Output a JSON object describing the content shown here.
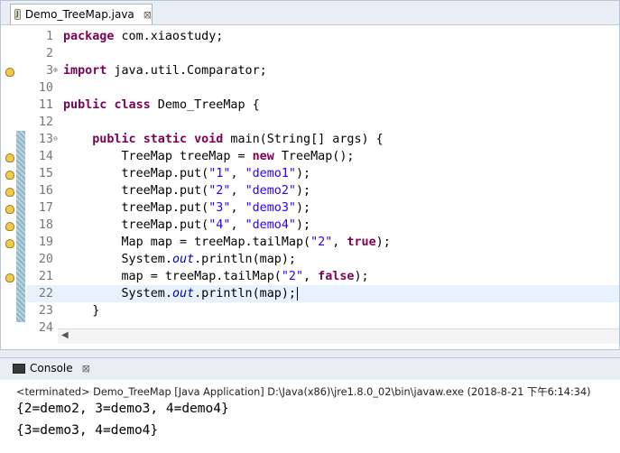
{
  "editor": {
    "tab_label": "Demo_TreeMap.java",
    "tab_close": "⊠"
  },
  "code_lines": [
    {
      "num": "1",
      "code": "package com.xiaostudy;"
    },
    {
      "num": "2",
      "code": ""
    },
    {
      "num": "3",
      "code": "import java.util.Comparator;"
    },
    {
      "num": "10",
      "code": ""
    },
    {
      "num": "11",
      "code": "public class Demo_TreeMap {"
    },
    {
      "num": "12",
      "code": ""
    },
    {
      "num": "13",
      "code": "    public static void main(String[] args) {"
    },
    {
      "num": "14",
      "code": "        TreeMap treeMap = new TreeMap();"
    },
    {
      "num": "15",
      "code": "        treeMap.put(\"1\", \"demo1\");"
    },
    {
      "num": "16",
      "code": "        treeMap.put(\"2\", \"demo2\");"
    },
    {
      "num": "17",
      "code": "        treeMap.put(\"3\", \"demo3\");"
    },
    {
      "num": "18",
      "code": "        treeMap.put(\"4\", \"demo4\");"
    },
    {
      "num": "19",
      "code": "        Map map = treeMap.tailMap(\"2\", true);"
    },
    {
      "num": "20",
      "code": "        System.out.println(map);"
    },
    {
      "num": "21",
      "code": "        map = treeMap.tailMap(\"2\", false);"
    },
    {
      "num": "22",
      "code": "        System.out.println(map);"
    },
    {
      "num": "23",
      "code": "    }"
    },
    {
      "num": "24",
      "code": ""
    }
  ],
  "console": {
    "tab_label": "Console",
    "tab_close": "⊠",
    "status": "<terminated> Demo_TreeMap [Java Application] D:\\Java(x86)\\jre1.8.0_02\\bin\\javaw.exe (2018-8-21 下午6:14:34)",
    "output": [
      "{2=demo2, 3=demo3, 4=demo4}",
      "{3=demo3, 4=demo4}"
    ]
  },
  "colors": {
    "keyword": "#7f0055",
    "string": "#2a00ff",
    "static_field": "#0000c0",
    "current_line": "#e8f2fe"
  }
}
